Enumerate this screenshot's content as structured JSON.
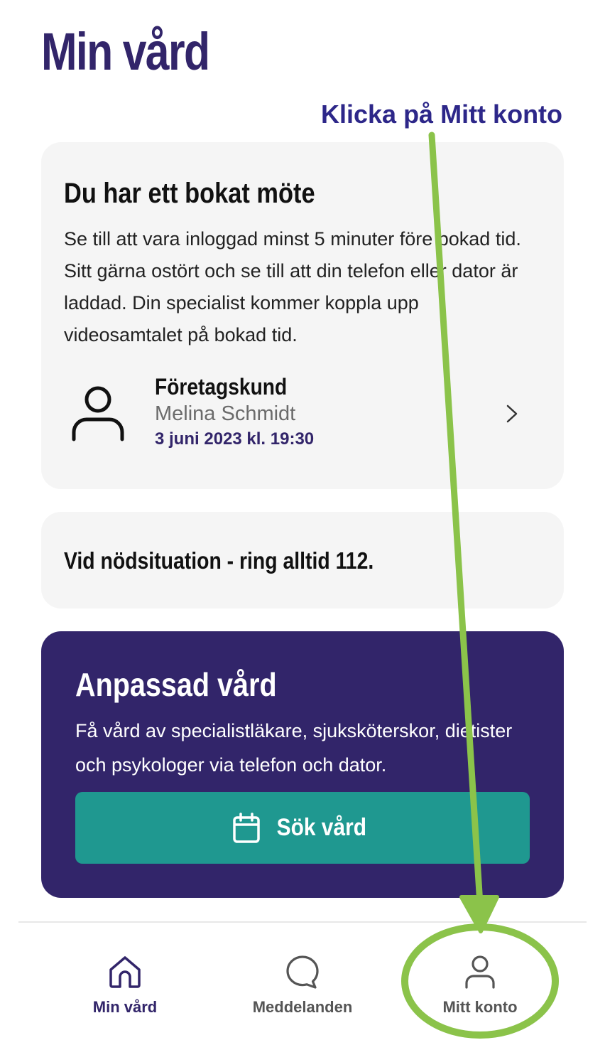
{
  "header": {
    "title": "Min vård"
  },
  "annotation": {
    "text": "Klicka på Mitt konto",
    "color": "#2d2789",
    "highlight_color": "#8bc34a"
  },
  "appointment": {
    "heading": "Du har ett bokat möte",
    "body": "Se till att vara inloggad minst 5 minuter före bokad tid. Sitt gärna ostört och se till att din telefon eller dator är laddad. Din specialist kommer koppla upp videosamtalet på bokad tid.",
    "booking": {
      "type": "Företagskund",
      "specialist": "Melina Schmidt",
      "datetime": "3 juni 2023 kl. 19:30",
      "icon": "user-icon"
    }
  },
  "emergency": {
    "text": "Vid nödsituation - ring alltid 112."
  },
  "promo": {
    "heading": "Anpassad vård",
    "body": "Få vård av specialistläkare, sjuksköterskor, dietister och psykologer via telefon och dator.",
    "button_label": "Sök vård",
    "button_icon": "calendar-icon"
  },
  "nav": {
    "items": [
      {
        "label": "Min vård",
        "icon": "home-icon",
        "active": true
      },
      {
        "label": "Meddelanden",
        "icon": "chat-bubble-icon",
        "active": false
      },
      {
        "label": "Mitt konto",
        "icon": "user-icon",
        "active": false
      }
    ]
  },
  "colors": {
    "brand": "#32256a",
    "accent": "#1f9890",
    "card_bg": "#f5f5f5"
  }
}
